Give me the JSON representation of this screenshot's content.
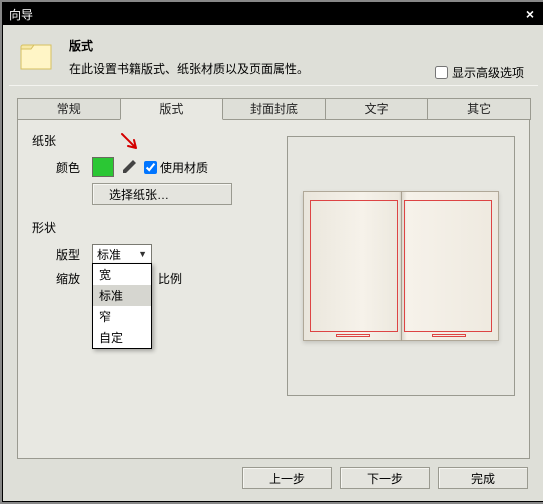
{
  "window": {
    "title": "向导"
  },
  "header": {
    "heading": "版式",
    "description": "在此设置书籍版式、纸张材质以及页面属性。",
    "show_advanced_label": "显示高级选项",
    "show_advanced_checked": false
  },
  "tabs": {
    "items": [
      {
        "label": "常规"
      },
      {
        "label": "版式"
      },
      {
        "label": "封面封底"
      },
      {
        "label": "文字"
      },
      {
        "label": "其它"
      }
    ],
    "active_index": 1
  },
  "paper": {
    "section_label": "纸张",
    "color_label": "颜色",
    "color_value": "#2bc734",
    "use_material_label": "使用材质",
    "use_material_checked": true,
    "select_paper_button": "选择纸张…"
  },
  "shape": {
    "section_label": "形状",
    "layout_label": "版型",
    "layout_value": "标准",
    "layout_options": [
      "宽",
      "标准",
      "窄",
      "自定"
    ],
    "scale_label": "缩放",
    "scale_suffix": "比例"
  },
  "footer": {
    "prev": "上一步",
    "next": "下一步",
    "finish": "完成"
  }
}
